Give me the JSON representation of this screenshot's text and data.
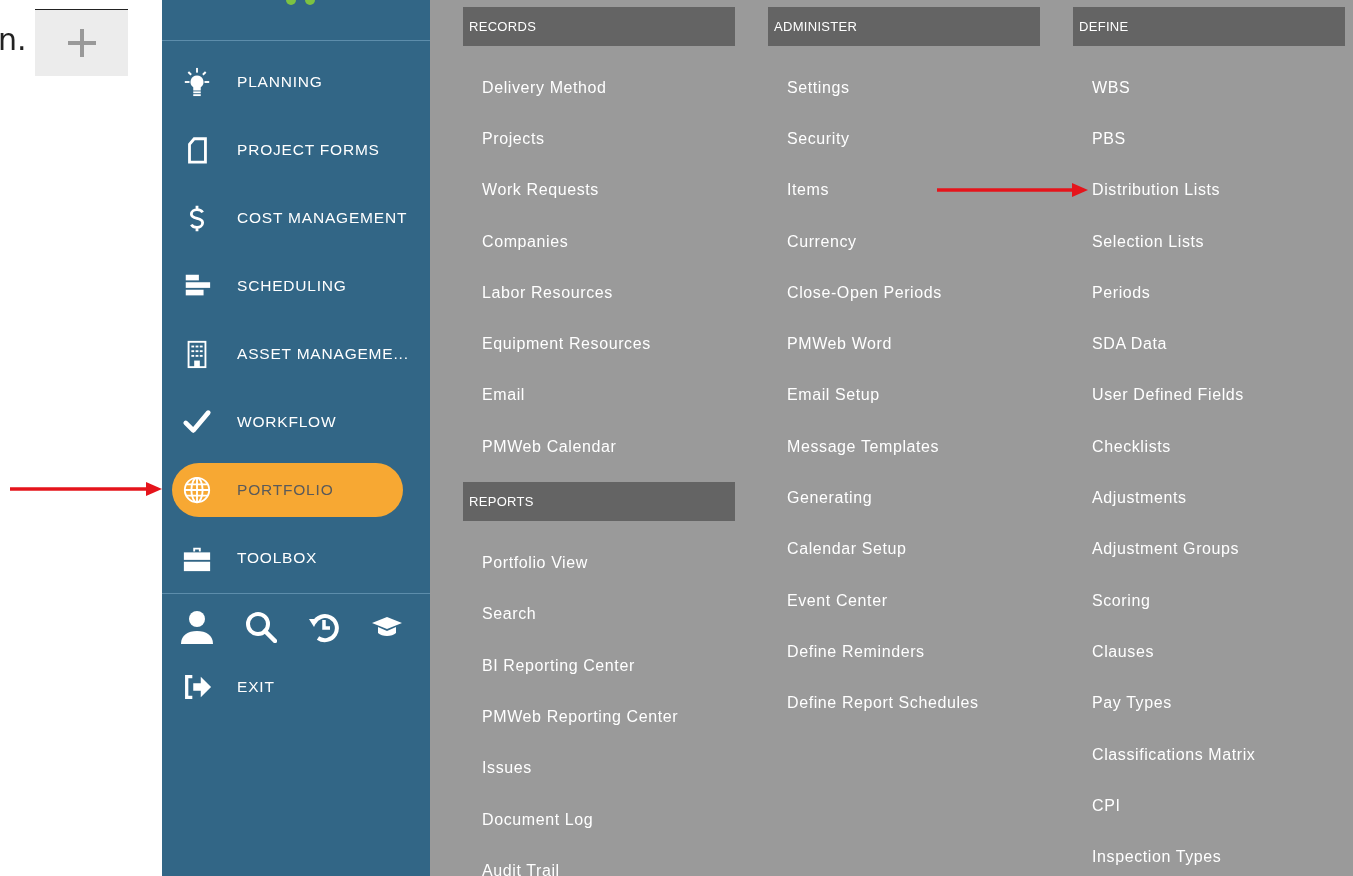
{
  "fragment": {
    "text": "n."
  },
  "sidebar": {
    "items": [
      {
        "label": "PLANNING",
        "kind": "bulb",
        "selected": false
      },
      {
        "label": "PROJECT FORMS",
        "kind": "document",
        "selected": false
      },
      {
        "label": "COST MANAGEMENT",
        "kind": "dollar",
        "selected": false
      },
      {
        "label": "SCHEDULING",
        "kind": "bars",
        "selected": false
      },
      {
        "label": "ASSET MANAGEME...",
        "kind": "building",
        "selected": false
      },
      {
        "label": "WORKFLOW",
        "kind": "check",
        "selected": false
      },
      {
        "label": "PORTFOLIO",
        "kind": "globe",
        "selected": true
      },
      {
        "label": "TOOLBOX",
        "kind": "briefcase",
        "selected": false
      }
    ],
    "exit": {
      "label": "EXIT"
    }
  },
  "menu": {
    "columns": [
      {
        "sections": [
          {
            "header": "RECORDS",
            "items": [
              "Delivery Method",
              "Projects",
              "Work Requests",
              "Companies",
              "Labor Resources",
              "Equipment Resources",
              "Email",
              "PMWeb Calendar"
            ]
          },
          {
            "header": "REPORTS",
            "items": [
              "Portfolio View",
              "Search",
              "BI Reporting Center",
              "PMWeb Reporting Center",
              "Issues",
              "Document Log",
              "Audit Trail"
            ]
          }
        ]
      },
      {
        "sections": [
          {
            "header": "ADMINISTER",
            "items": [
              "Settings",
              "Security",
              "Items",
              "Currency",
              "Close-Open Periods",
              "PMWeb Word",
              "Email Setup",
              "Message Templates",
              "Generating",
              "Calendar Setup",
              "Event Center",
              "Define Reminders",
              "Define Report Schedules"
            ]
          }
        ]
      },
      {
        "sections": [
          {
            "header": "DEFINE",
            "items": [
              "WBS",
              "PBS",
              "Distribution Lists",
              "Selection Lists",
              "Periods",
              "SDA Data",
              "User Defined Fields",
              "Checklists",
              "Adjustments",
              "Adjustment Groups",
              "Scoring",
              "Clauses",
              "Pay Types",
              "Classifications Matrix",
              "CPI",
              "Inspection Types"
            ]
          }
        ]
      }
    ]
  }
}
